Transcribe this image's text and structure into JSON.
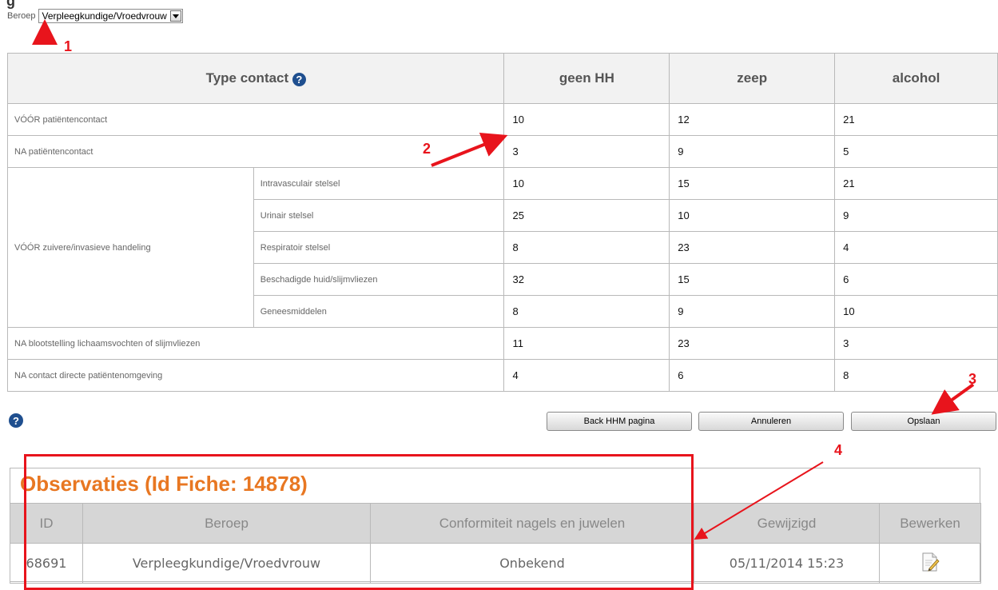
{
  "header_clip": "g",
  "beroep": {
    "label": "Beroep",
    "selected": "Verpleegkundige/Vroedvrouw"
  },
  "grid": {
    "headers": {
      "type_contact": "Type contact",
      "geen_hh": "geen HH",
      "zeep": "zeep",
      "alcohol": "alcohol"
    },
    "help_glyph": "?",
    "rows": [
      {
        "label": "VÓÓR patiëntencontact",
        "geen_hh": "10",
        "zeep": "12",
        "alcohol": "21"
      },
      {
        "label": "NA patiëntencontact",
        "geen_hh": "3",
        "zeep": "9",
        "alcohol": "5"
      },
      {
        "group": "VÓÓR zuivere/invasieve handeling",
        "label": "Intravasculair stelsel",
        "geen_hh": "10",
        "zeep": "15",
        "alcohol": "21"
      },
      {
        "label": "Urinair stelsel",
        "geen_hh": "25",
        "zeep": "10",
        "alcohol": "9"
      },
      {
        "label": "Respiratoir stelsel",
        "geen_hh": "8",
        "zeep": "23",
        "alcohol": "4"
      },
      {
        "label": "Beschadigde huid/slijmvliezen",
        "geen_hh": "32",
        "zeep": "15",
        "alcohol": "6"
      },
      {
        "label": "Geneesmiddelen",
        "geen_hh": "8",
        "zeep": "9",
        "alcohol": "10"
      },
      {
        "label": "NA blootstelling lichaamsvochten of slijmvliezen",
        "geen_hh": "11",
        "zeep": "23",
        "alcohol": "3"
      },
      {
        "label": "NA contact directe patiëntenomgeving",
        "geen_hh": "4",
        "zeep": "6",
        "alcohol": "8"
      }
    ]
  },
  "buttons": {
    "back": "Back HHM pagina",
    "cancel": "Annuleren",
    "save": "Opslaan"
  },
  "observaties": {
    "title": "Observaties (Id Fiche: 14878)",
    "columns": [
      "ID",
      "Beroep",
      "Conformiteit nagels en juwelen",
      "Gewijzigd",
      "Bewerken"
    ],
    "row": {
      "id": "68691",
      "beroep": "Verpleegkundige/Vroedvrouw",
      "conformiteit": "Onbekend",
      "gewijzigd": "05/11/2014 15:23"
    }
  },
  "annotations": [
    "1",
    "2",
    "3",
    "4"
  ],
  "colors": {
    "accent_orange": "#e87722",
    "annotation_red": "#e8141c",
    "help_blue": "#1f4f8f"
  },
  "icons": {
    "help": "help-circle-icon",
    "edit": "edit-document-icon",
    "dropdown": "chevron-down-icon"
  }
}
